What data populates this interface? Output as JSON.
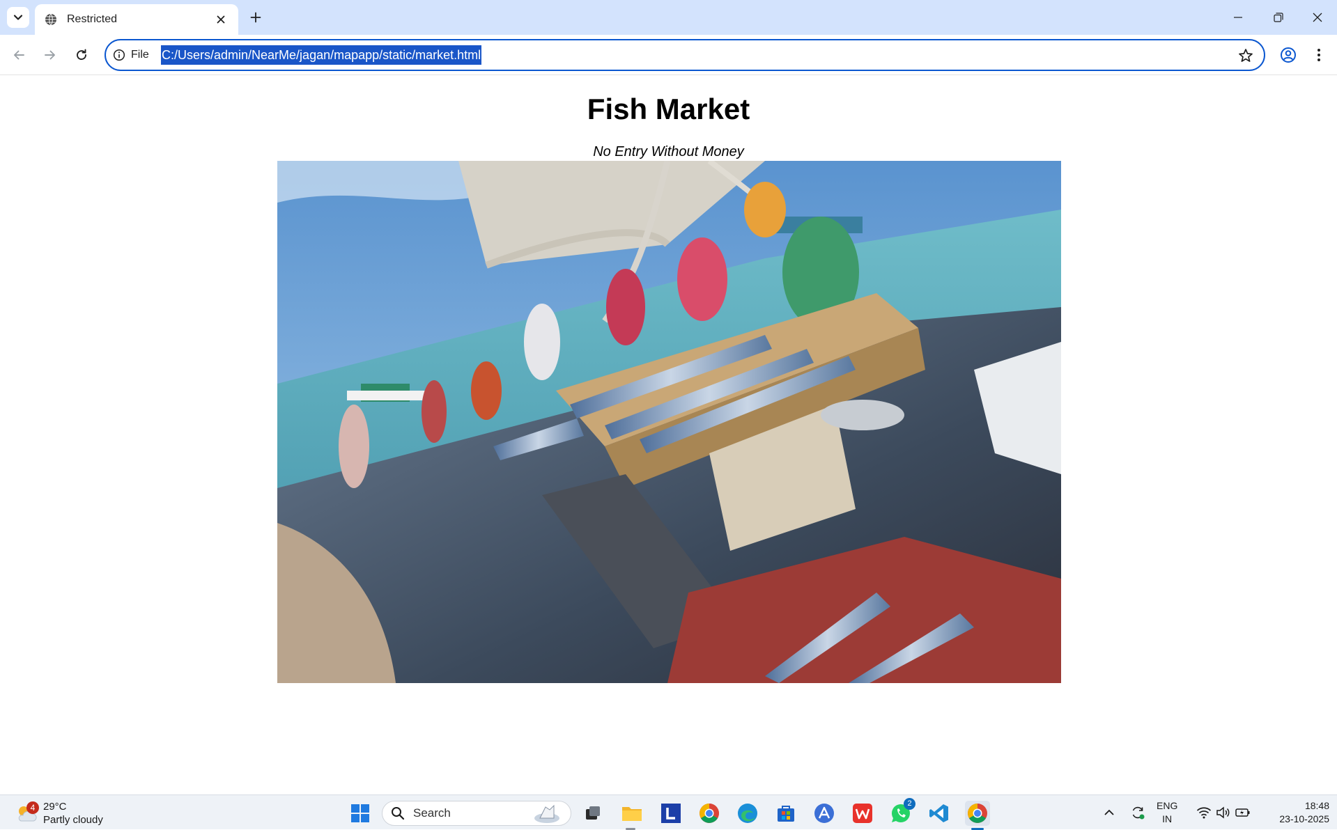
{
  "browser": {
    "tab": {
      "title": "Restricted"
    },
    "omnibox": {
      "site_info_label": "File",
      "url": "C:/Users/admin/NearMe/jagan/mapapp/static/market.html"
    },
    "icons": {
      "tab_list": "chevron-down-icon",
      "favicon": "globe-icon",
      "tab_close": "close-icon",
      "new_tab": "plus-icon",
      "back": "back-arrow-icon",
      "forward": "forward-arrow-icon",
      "reload": "reload-icon",
      "bookmark": "star-icon",
      "profile": "profile-icon",
      "menu": "kebab-menu-icon"
    }
  },
  "page": {
    "title": "Fish Market",
    "subtitle": "No Entry Without Money",
    "image_subject": "photo-of-fish-market"
  },
  "taskbar": {
    "weather": {
      "temperature": "29°C",
      "condition": "Partly cloudy",
      "badge": "4"
    },
    "search": {
      "label": "Search"
    },
    "apps": [
      "start",
      "search",
      "task-view",
      "file-explorer",
      "l-app",
      "chrome",
      "edge",
      "microsoft-store",
      "ai-app",
      "wps-office",
      "whatsapp",
      "vs-code",
      "chrome-active"
    ],
    "whatsapp_badge": "2",
    "language": {
      "line1": "ENG",
      "line2": "IN"
    },
    "clock": {
      "time": "18:48",
      "date": "23-10-2025"
    }
  }
}
